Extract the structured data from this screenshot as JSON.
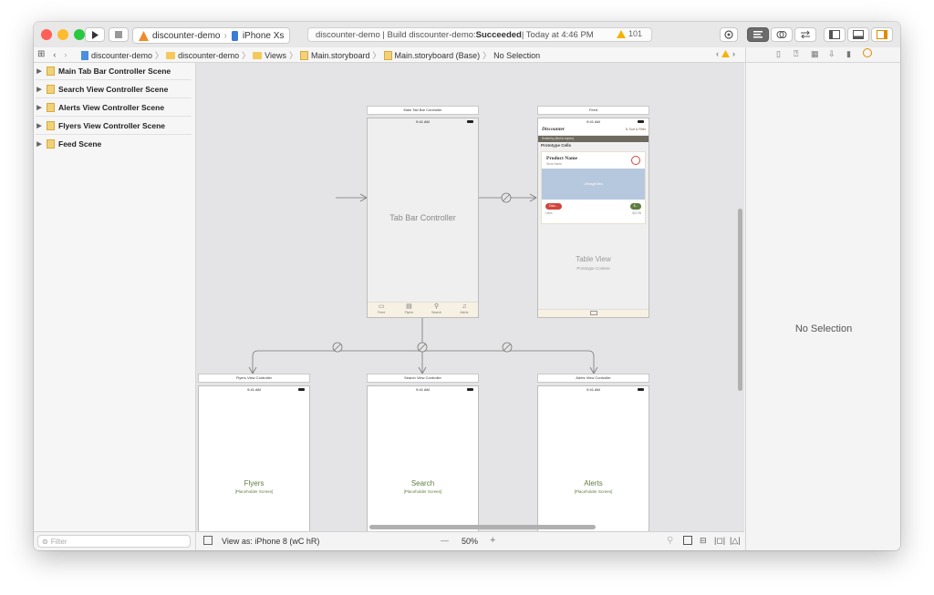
{
  "toolbar": {
    "scheme_project": "discounter-demo",
    "scheme_device": "iPhone Xs",
    "activity_prefix": "discounter-demo | Build discounter-demo: ",
    "activity_status": "Succeeded",
    "activity_suffix": " | Today at 4:46 PM",
    "warning_count": "101"
  },
  "breadcrumb": {
    "items": [
      "discounter-demo",
      "discounter-demo",
      "Views",
      "Main.storyboard",
      "Main.storyboard (Base)",
      "No Selection"
    ]
  },
  "navigator": {
    "scenes": [
      "Main Tab Bar Controller Scene",
      "Search View Controller Scene",
      "Alerts View Controller Scene",
      "Flyers View Controller Scene",
      "Feed Scene"
    ],
    "filter_placeholder": "Filter"
  },
  "canvas": {
    "tab_scene": {
      "title": "Main Tab Bar Controller",
      "time": "9:41 AM",
      "label": "Tab Bar Controller",
      "tabs": [
        "Feed",
        "Flyers",
        "Search",
        "Alerts"
      ]
    },
    "feed_scene": {
      "title": "Feed",
      "time": "9:41 AM",
      "nav_title": "Discounter",
      "sort_filter": "⇅ Sort & Filter",
      "sorted_by": "Sorted by (first to expire)",
      "prototype_cells": "Prototype Cells",
      "product_name": "Product Name",
      "store_name": "Store Name",
      "image_placeholder": "UIImageView",
      "disc_label": "Disc...",
      "price_badge": "$...",
      "unit_label": "Liebs",
      "price": "$22.95",
      "table_view": "Table View",
      "table_sub": "Prototype Content"
    },
    "flyers_scene": {
      "title": "Flyers View Controller",
      "time": "9:41 AM",
      "label": "Flyers",
      "sub": "[Placeholder Screen]"
    },
    "search_scene": {
      "title": "Search View Controller",
      "time": "9:41 AM",
      "label": "Search",
      "sub": "[Placeholder Screen]"
    },
    "alerts_scene": {
      "title": "Alerts View Controller",
      "time": "9:41 AM",
      "label": "Alerts",
      "sub": "[Placeholder Screen]"
    }
  },
  "bottom_bar": {
    "view_as": "View as: iPhone 8 (wC hR)",
    "zoom_minus": "—",
    "zoom": "50%",
    "zoom_plus": "+"
  },
  "inspector": {
    "empty_label": "No Selection"
  },
  "colors": {
    "accent_green": "#5e7c3e",
    "badge_red": "#d0453a",
    "image_blue": "#b6c8de",
    "warning_yellow": "#f5b301"
  }
}
